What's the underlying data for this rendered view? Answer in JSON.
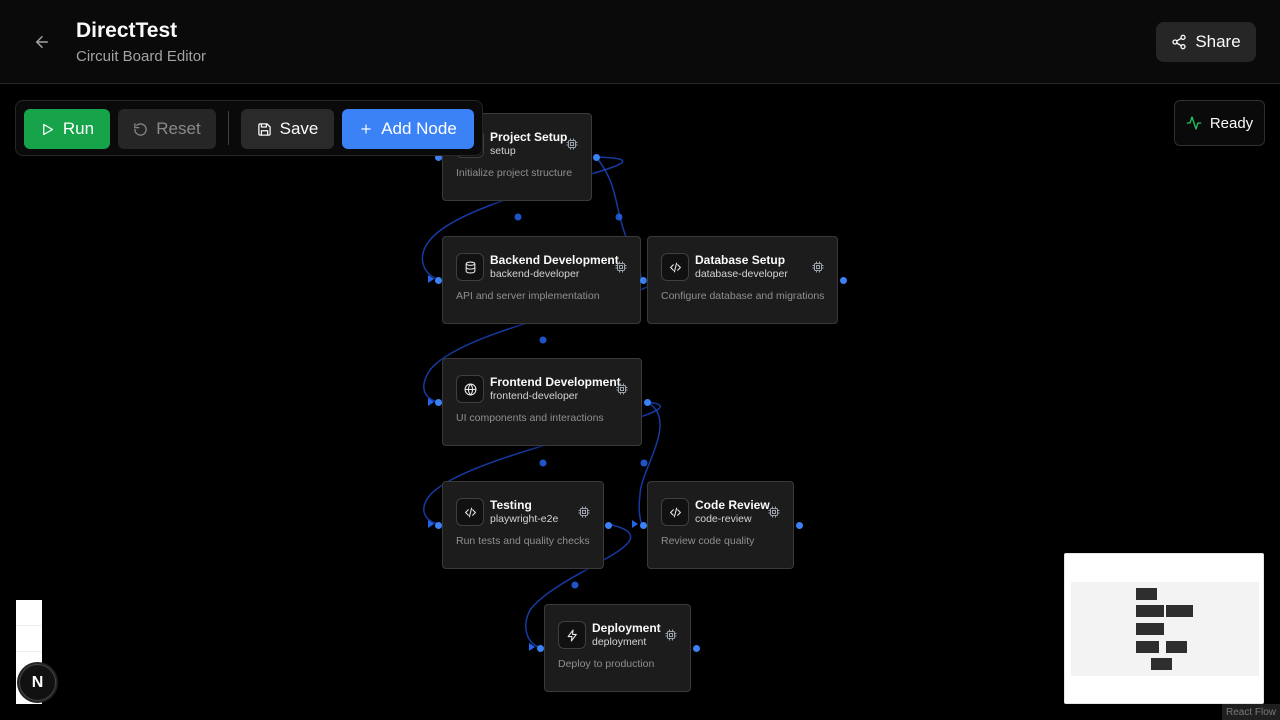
{
  "header": {
    "title": "DirectTest",
    "subtitle": "Circuit Board Editor",
    "share_label": "Share"
  },
  "toolbar": {
    "run_label": "Run",
    "reset_label": "Reset",
    "save_label": "Save",
    "add_node_label": "Add Node"
  },
  "status": {
    "label": "Ready",
    "icon": "activity-icon",
    "color": "#22c55e"
  },
  "nodes": [
    {
      "title": "Project Setup",
      "type": "setup",
      "description": "Initialize project structure",
      "icon": "box-icon"
    },
    {
      "title": "Backend Development",
      "type": "backend-developer",
      "description": "API and server implementation",
      "icon": "database-icon"
    },
    {
      "title": "Database Setup",
      "type": "database-developer",
      "description": "Configure database and migrations",
      "icon": "code-icon"
    },
    {
      "title": "Frontend Development",
      "type": "frontend-developer",
      "description": "UI components and interactions",
      "icon": "globe-icon"
    },
    {
      "title": "Testing",
      "type": "playwright-e2e",
      "description": "Run tests and quality checks",
      "icon": "code-icon"
    },
    {
      "title": "Code Review",
      "type": "code-review",
      "description": "Review code quality",
      "icon": "code-icon"
    },
    {
      "title": "Deployment",
      "type": "deployment",
      "description": "Deploy to production",
      "icon": "zap-icon"
    }
  ],
  "attribution": "React Flow",
  "dev_badge": "N",
  "colors": {
    "accent": "#3b82f6",
    "run": "#16a34a",
    "edge": "#1e3a8a"
  }
}
